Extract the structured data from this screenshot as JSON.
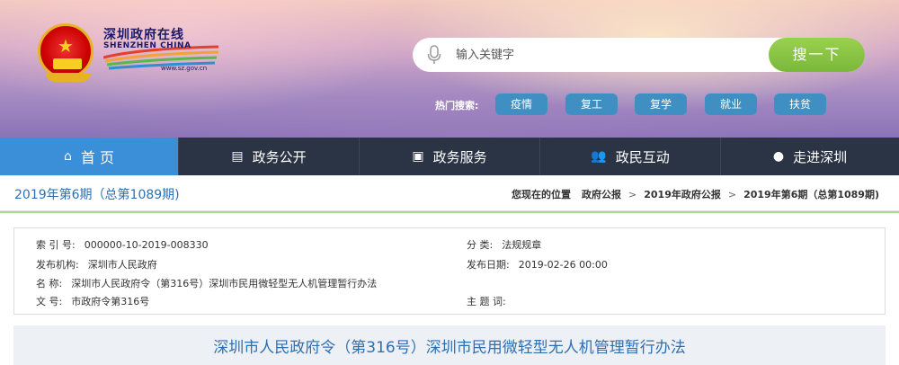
{
  "header": {
    "logo_cn": "深圳政府在线",
    "logo_en": "SHENZHEN CHINA",
    "logo_url": "www.sz.gov.cn"
  },
  "search": {
    "placeholder": "输入关键字",
    "button_label": "搜一下",
    "hot_label": "热门搜索:",
    "hot_tags": [
      "疫情",
      "复工",
      "复学",
      "就业",
      "扶贫"
    ]
  },
  "nav": {
    "items": [
      {
        "label": "首 页",
        "icon": "home-icon",
        "glyph": "⌂"
      },
      {
        "label": "政务公开",
        "icon": "news-icon",
        "glyph": "▤"
      },
      {
        "label": "政务服务",
        "icon": "monitor-icon",
        "glyph": "▣"
      },
      {
        "label": "政民互动",
        "icon": "people-icon",
        "glyph": "👥"
      },
      {
        "label": "走进深圳",
        "icon": "chat-icon",
        "glyph": "●"
      }
    ]
  },
  "issue": {
    "title": "2019年第6期（总第1089期)"
  },
  "breadcrumb": {
    "lead": "您现在的位置",
    "items": [
      "政府公报",
      "2019年政府公报",
      "2019年第6期（总第1089期)"
    ]
  },
  "info": {
    "index_key": "索 引 号:",
    "index_value": "000000-10-2019-008330",
    "category_key": "分    类:",
    "category_value": "法规规章",
    "publisher_key": "发布机构:",
    "publisher_value": "深圳市人民政府",
    "date_key": "发布日期:",
    "date_value": "2019-02-26 00:00",
    "name_key": "名    称:",
    "name_value": "深圳市人民政府令（第316号）深圳市民用微轻型无人机管理暂行办法",
    "docno_key": "文    号:",
    "docno_value": "市政府令第316号",
    "subject_key": "主 题 词:",
    "subject_value": ""
  },
  "document": {
    "title": "深圳市人民政府令（第316号）深圳市民用微轻型无人机管理暂行办法"
  },
  "colors": {
    "nav_bg": "#2b3445",
    "nav_active": "#3a8fd8",
    "search_button": "#7ab83a",
    "tag_bg": "#3f8fc2",
    "title_blue": "#2d6fb3"
  }
}
